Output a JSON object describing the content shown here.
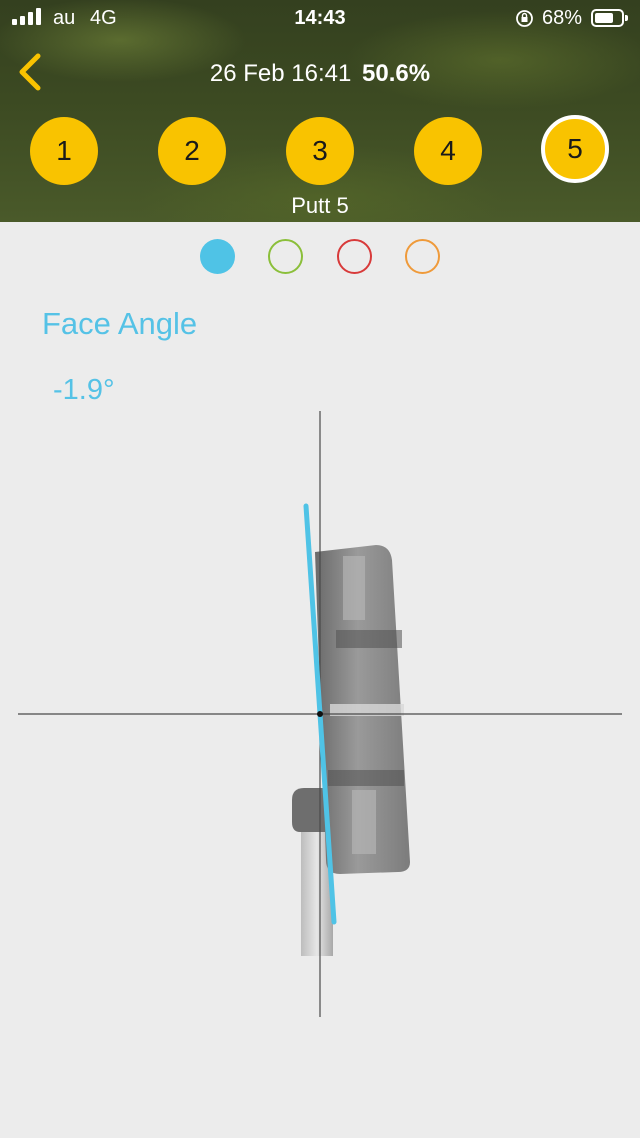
{
  "status_bar": {
    "carrier": "au",
    "network": "4G",
    "time": "14:43",
    "battery_percent": "68%"
  },
  "nav": {
    "date": "26 Feb 16:41",
    "score": "50.6%"
  },
  "putts": [
    {
      "label": "1"
    },
    {
      "label": "2"
    },
    {
      "label": "3"
    },
    {
      "label": "4"
    },
    {
      "label": "5"
    }
  ],
  "selected_putt_index": 4,
  "selected_putt_label": "Putt 5",
  "view_dots": [
    {
      "color": "#4fc3e6",
      "filled": true
    },
    {
      "color": "#8bbf3a",
      "filled": false
    },
    {
      "color": "#d83a3a",
      "filled": false
    },
    {
      "color": "#ef9a3a",
      "filled": false
    }
  ],
  "metric": {
    "title": "Face Angle",
    "value": "-1.9°",
    "angle_degrees": -1.9,
    "line_color": "#4fc3e6"
  },
  "colors": {
    "accent": "#f9c300",
    "metric_text": "#55c2e6"
  }
}
